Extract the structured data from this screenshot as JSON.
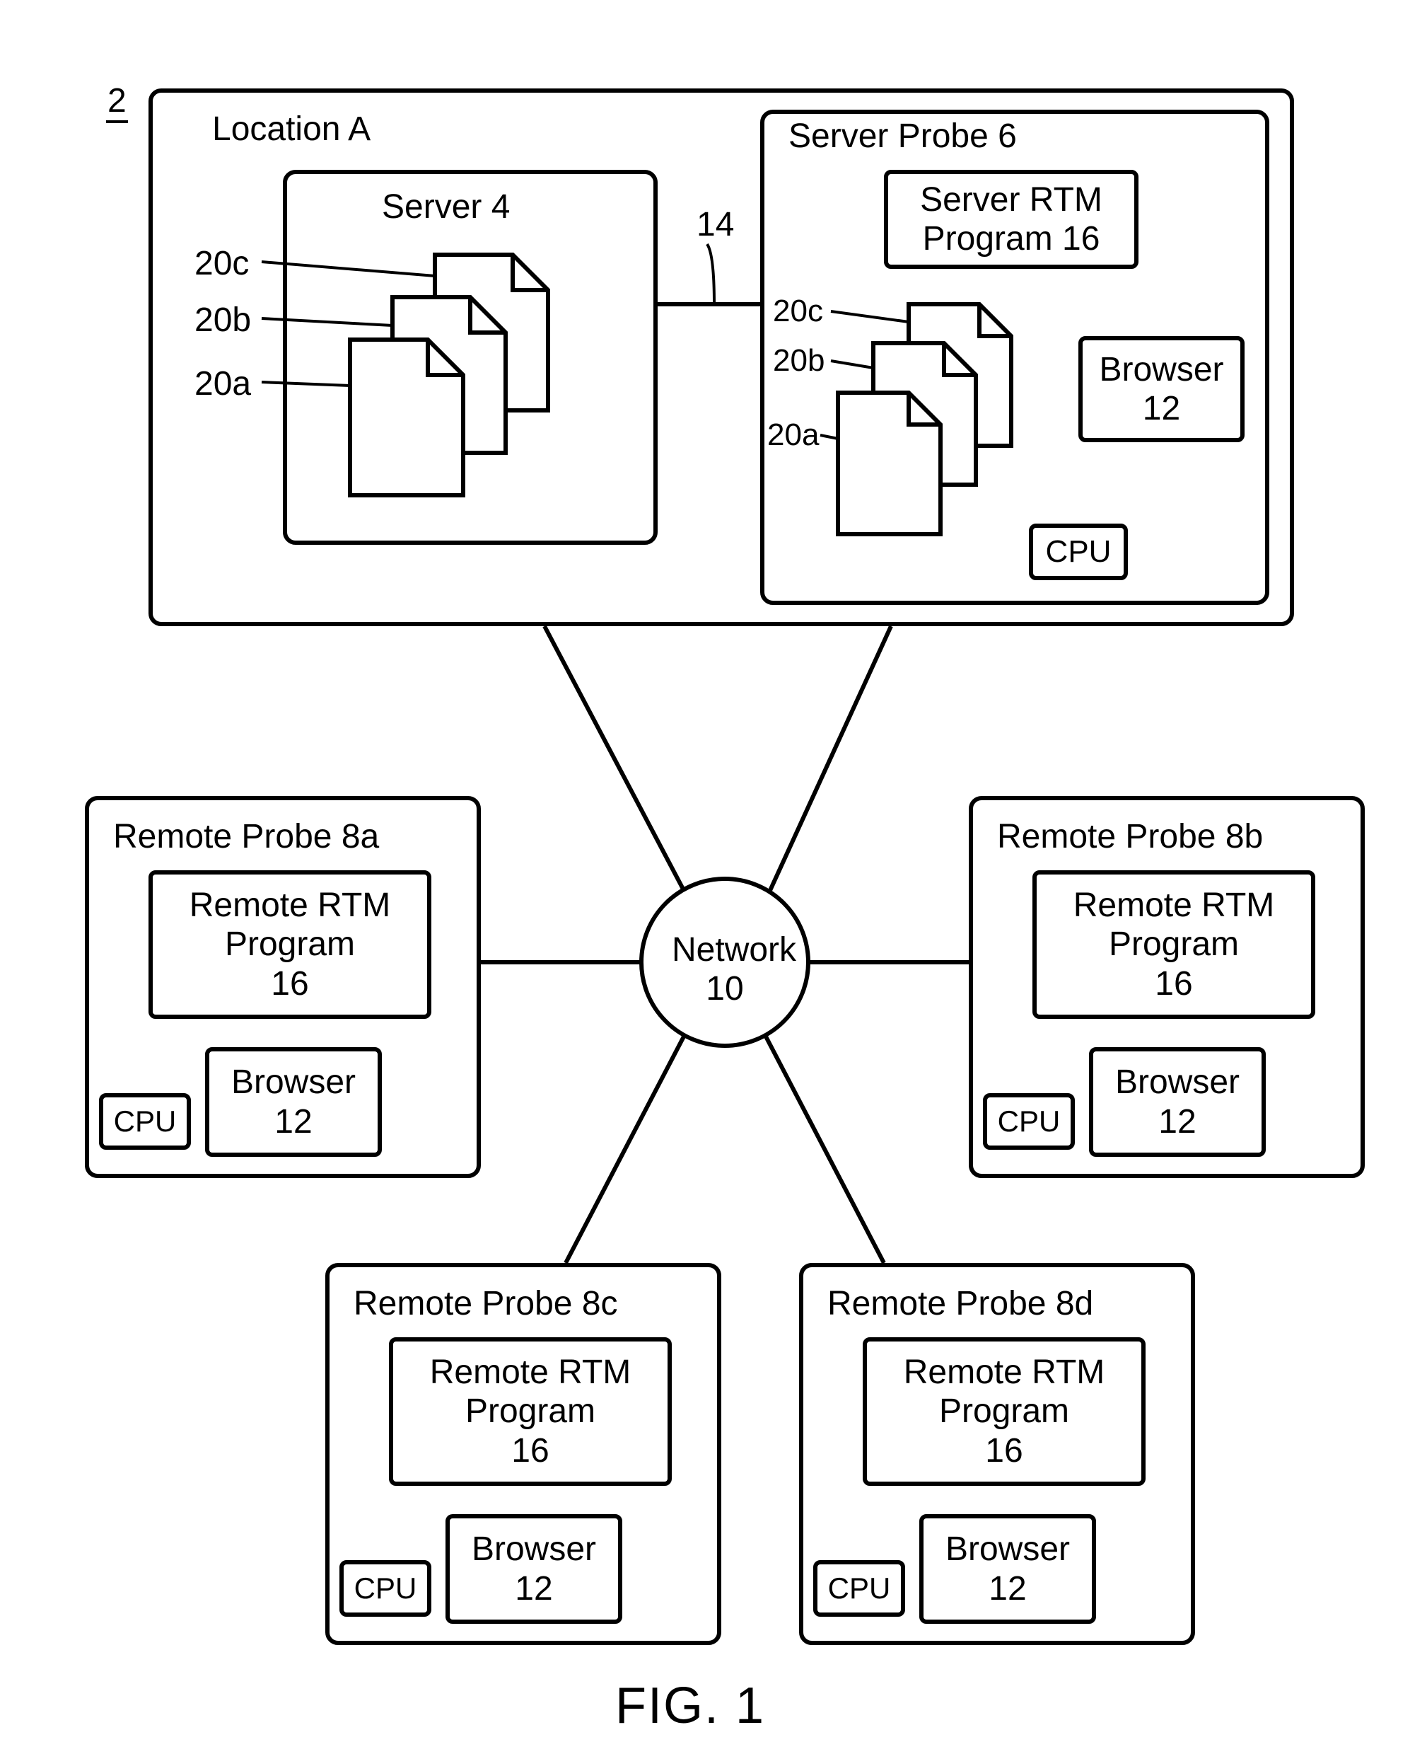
{
  "figure_ref": "2",
  "figure_caption": "FIG. 1",
  "location_a": {
    "title": "Location A",
    "server": {
      "title": "Server 4",
      "connector_label": "14",
      "docs": {
        "a": "20a",
        "b": "20b",
        "c": "20c"
      }
    },
    "server_probe": {
      "title": "Server Probe 6",
      "rtm": "Server RTM\nProgram 16",
      "browser": "Browser\n12",
      "cpu": "CPU",
      "docs": {
        "a": "20a",
        "b": "20b",
        "c": "20c"
      }
    }
  },
  "network": {
    "label": "Network\n10"
  },
  "remote_probes": {
    "a": {
      "title": "Remote Probe 8a",
      "rtm": "Remote RTM\nProgram\n16",
      "browser": "Browser\n12",
      "cpu": "CPU"
    },
    "b": {
      "title": "Remote Probe 8b",
      "rtm": "Remote RTM\nProgram\n16",
      "browser": "Browser\n12",
      "cpu": "CPU"
    },
    "c": {
      "title": "Remote Probe 8c",
      "rtm": "Remote RTM\nProgram\n16",
      "browser": "Browser\n12",
      "cpu": "CPU"
    },
    "d": {
      "title": "Remote Probe 8d",
      "rtm": "Remote RTM\nProgram\n16",
      "browser": "Browser\n12",
      "cpu": "CPU"
    }
  }
}
